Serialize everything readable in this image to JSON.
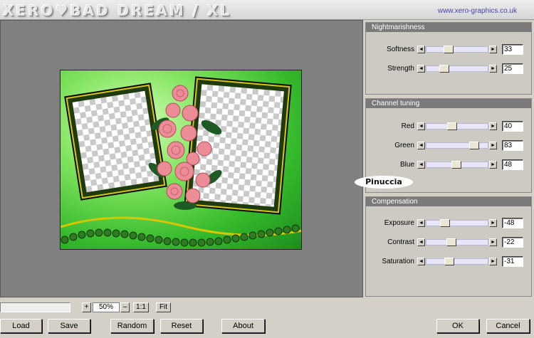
{
  "window": {
    "title": "XERO♥BAD DREAM / XL",
    "url": "www.xero-graphics.co.uk"
  },
  "groups": [
    {
      "title": "Nightmarishness",
      "sliders": [
        {
          "label": "Softness",
          "value": "33",
          "level": 0.33
        },
        {
          "label": "Strength",
          "value": "25",
          "level": 0.25
        }
      ]
    },
    {
      "title": "Channel tuning",
      "sliders": [
        {
          "label": "Red",
          "value": "40",
          "level": 0.4
        },
        {
          "label": "Green",
          "value": "83",
          "level": 0.83
        },
        {
          "label": "Blue",
          "value": "48",
          "level": 0.48
        }
      ]
    },
    {
      "title": "Compensation",
      "sliders": [
        {
          "label": "Exposure",
          "value": "-48",
          "level": 0.26
        },
        {
          "label": "Contrast",
          "value": "-22",
          "level": 0.39
        },
        {
          "label": "Saturation",
          "value": "-31",
          "level": 0.345
        }
      ]
    }
  ],
  "watermark": "Pinuccia",
  "zoom": {
    "plus": "+",
    "value": "50%",
    "minus": "–",
    "one_to_one": "1:1",
    "fit": "Fit"
  },
  "buttons": {
    "load": "Load",
    "save": "Save",
    "random": "Random",
    "reset": "Reset",
    "about": "About",
    "ok": "OK",
    "cancel": "Cancel"
  },
  "icons": {
    "left_arrow": "◄",
    "right_arrow": "►"
  }
}
